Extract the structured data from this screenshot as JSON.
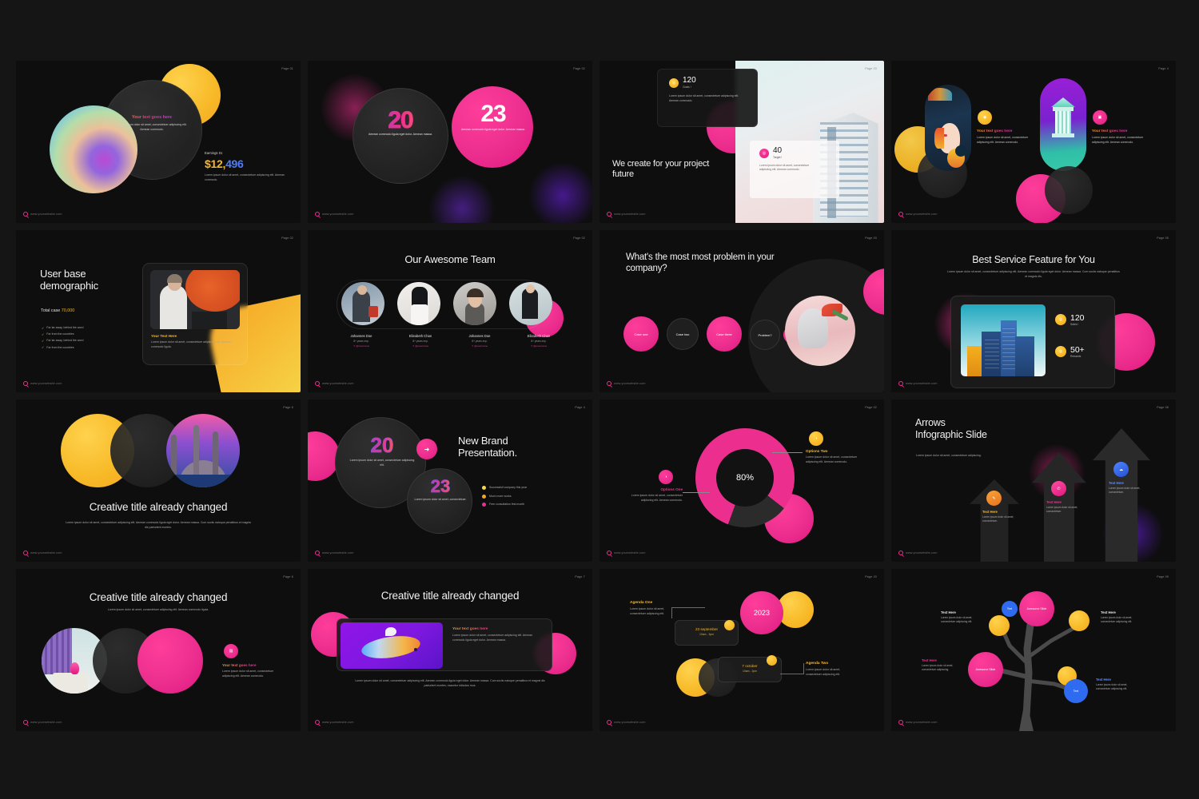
{
  "meta": {
    "canvas_background": "#151515",
    "slide_background": "#0e0e0e",
    "accent_pink": "#ec2f8f",
    "accent_yellow": "#f5a623",
    "accent_purple": "#7b5cf0",
    "accent_blue": "#2f6bf0",
    "footer_url": "www.yourwebsite.com"
  },
  "common": {
    "lorem_short": "Lorem ipsum dolor sit amet, consectetuer adipiscing elit. Aenean commodo.",
    "lorem_med": "Lorem ipsum dolor sit amet, consectetuer adipiscing elit. Aenean commodo ligula eget dolor. Aenean massa.",
    "aenean": "Aenean commodo ligula eget dolor. Aenean massa.",
    "your_text_goes_here": "Your text goes here",
    "text_here": "Text Here",
    "your_text_here": "Your Text Here"
  },
  "slides": [
    {
      "id": "slide-01-earnings",
      "page": "Page 01",
      "heading": "Your text goes here",
      "body": "Lorem ipsum dolor sit amet, consectetuer adipiscing elit. Aenean commodo.",
      "stat_label": "Earnings 01",
      "stat_value_a": "$12,",
      "stat_value_b": "496",
      "stat_body": "Lorem ipsum dolor sit amet, consectetuer adipiscing elit. Aenean commodo."
    },
    {
      "id": "slide-02-2023",
      "page": "Page 02",
      "left_number": "20",
      "right_number": "23",
      "left_body": "Aenean commodo ligula eget dolor. Aenean massa.",
      "right_body": "Aenean commodo ligula eget dolor. Aenean massa."
    },
    {
      "id": "slide-03-we-create",
      "page": "Page 03",
      "title": "We create for your project future",
      "stat_one_value": "120",
      "stat_one_label": "Goals !",
      "stat_one_body": "Lorem ipsum dolor sit amet, consectetuer adipiscing elit. Aenean commodo.",
      "stat_two_value": "40",
      "stat_two_label": "Target !",
      "stat_two_body": "Lorem ipsum dolor sit amet, consectetuer adipiscing elit. Aenean commodo."
    },
    {
      "id": "slide-04-two-features",
      "page": "Page 4",
      "left_heading": "Your text goes here",
      "left_body": "Lorem ipsum dolor sit amet, consectetuer adipiscing elit. Aenean commodo.",
      "right_heading": "Your text goes here",
      "right_body": "Lorem ipsum dolor sit amet, consectetuer adipiscing elit. Aenean commodo."
    },
    {
      "id": "slide-05-user-base",
      "page": "Page 02",
      "title_line1": "User base",
      "title_line2": "demographic",
      "total_label": "Total case",
      "total_value": "70,000",
      "bullets": [
        "Far far away, behind the word",
        "Far from the countries",
        "Far far away, behind the word",
        "Far from the countries"
      ],
      "card_heading": "Your Text Here",
      "card_body": "Lorem ipsum dolor sit amet, consectetuer adipiscing elit. Aenean commodo ligula."
    },
    {
      "id": "slide-06-team",
      "page": "Page 02",
      "title": "Our Awesome Team",
      "members": [
        {
          "name": "Johannes Doe",
          "role": "8+ years exp.",
          "handle": "@username"
        },
        {
          "name": "Elizabeth Chan",
          "role": "8+ years exp.",
          "handle": "@username"
        },
        {
          "name": "Johannes Doe",
          "role": "8+ years exp.",
          "handle": "@username"
        },
        {
          "name": "Elizabeth Chan",
          "role": "8+ years exp.",
          "handle": "@username"
        }
      ]
    },
    {
      "id": "slide-07-problem",
      "page": "Page 03",
      "title": "What's the most most problem in your company?",
      "cases": [
        "Case one",
        "Case two",
        "Case three",
        "Problem?"
      ]
    },
    {
      "id": "slide-08-best-service",
      "page": "Page 05",
      "title": "Best Service Feature for You",
      "subtitle": "Lorem ipsum dolor sit amet, consectetuer adipiscing elit. Aenean commodo ligula eget dolor. Aenean massa. Cum sociis natoque penatibus et magnis dis.",
      "stat_one_value": "120",
      "stat_one_label": "Sales !",
      "stat_two_value": "50+",
      "stat_two_label": "Rewards"
    },
    {
      "id": "slide-09-creative-circles",
      "page": "Page 6",
      "title": "Creative title already changed",
      "body": "Lorem ipsum dolor sit amet, consectetuer adipiscing elit. Aenean commodo ligula eget dolor. Aenean massa. Cum sociis natoque penatibus et magnis dis parturient montes."
    },
    {
      "id": "slide-10-new-brand",
      "page": "Page 4",
      "number_one": "20",
      "number_two": "23",
      "number_one_body": "Lorem ipsum dolor sit amet, consectetuer adipiscing elit.",
      "number_two_body": "Lorem ipsum dolor sit amet, consectetuer.",
      "title_line1": "New Brand",
      "title_line2": "Presentation.",
      "bullets": [
        {
          "text": "Successfull company this year",
          "color": "#f7d84d"
        },
        {
          "text": "Much more works",
          "color": "#f5a623"
        },
        {
          "text": "Free consultation first month",
          "color": "#ec2f8f"
        }
      ]
    },
    {
      "id": "slide-11-donut",
      "page": "Page 02",
      "center_value": "80%",
      "option_one_title": "Options One",
      "option_one_body": "Lorem ipsum dolor sit amet, consectetuer adipiscing elit. Aenean commodo.",
      "option_two_title": "Options Two",
      "option_two_body": "Lorem ipsum dolor sit amet, consectetuer adipiscing elit. Aenean commodo.",
      "chart_data": {
        "type": "pie",
        "title": "80%",
        "categories": [
          "Options One",
          "Options Two"
        ],
        "values": [
          80,
          20
        ],
        "colors": [
          "#ec2f8f",
          "#2b2b2b"
        ],
        "legend": "right"
      }
    },
    {
      "id": "slide-12-arrows",
      "page": "Page 08",
      "title_line1": "Arrows",
      "title_line2": "Infographic Slide",
      "subtitle": "Lorem ipsum dolor sit amet, consectetuer adipiscing.",
      "items": [
        {
          "label": "Text Here",
          "body": "Lorem ipsum dolor sit amet, consectetuer.",
          "color": "#f5a623"
        },
        {
          "label": "Text Here",
          "body": "Lorem ipsum dolor sit amet, consectetuer.",
          "color": "#ec2f8f"
        },
        {
          "label": "Text Here",
          "body": "Lorem ipsum dolor sit amet, consectetuer.",
          "color": "#2f6bf0"
        }
      ]
    },
    {
      "id": "slide-13-creative-three",
      "page": "Page 8",
      "title": "Creative title already changed",
      "subtitle": "Lorem ipsum dolor sit amet, consectetuer adipiscing elit. Aenean commodo ligula.",
      "side_heading": "Your text goes here",
      "side_body": "Lorem ipsum dolor sit amet, consectetuer adipiscing elit. Aenean commodo."
    },
    {
      "id": "slide-14-phone",
      "page": "Page 7",
      "title": "Creative title already changed",
      "card_heading": "Your text goes here",
      "card_body": "Lorem ipsum dolor sit amet, consectetuer adipiscing elit. Aenean commodo ligula eget dolor. Aenean massa.",
      "bottom_body": "Lorem ipsum dolor sit amet, consectetuer adipiscing elit. Aenean commodo ligula eget dolor. Aenean massa. Cum sociis natoque penatibus et magnis dis parturient montes, nascetur ridiculus mus."
    },
    {
      "id": "slide-15-agenda",
      "page": "Page 20",
      "year": "2023",
      "agenda_one_title": "Agenda One",
      "agenda_one_body": "Lorem ipsum dolor sit amet, consectetuer adipiscing elit.",
      "agenda_two_title": "Agenda Two",
      "agenda_two_body": "Lorem ipsum dolor sit amet, consectetuer adipiscing elit.",
      "date_one": "23 september",
      "time_one": "10am - 3pm",
      "date_two": "7 october",
      "time_two": "10am - 2pm"
    },
    {
      "id": "slide-16-tree",
      "page": "Page 09",
      "nodes": [
        {
          "label": "Text",
          "color": "#2f6bf0"
        },
        {
          "label": "Awesome Slide",
          "color": "#ec2f8f"
        },
        {
          "label": "Awesome Slide",
          "color": "#ec2f8f"
        },
        {
          "label": "Text",
          "color": "#2f6bf0"
        }
      ],
      "callouts": [
        {
          "title": "Text Here",
          "body": "Lorem ipsum dolor sit amet, consectetuer adipiscing elit.",
          "color": "#e8e8e8"
        },
        {
          "title": "Text Here",
          "body": "Lorem ipsum dolor sit amet, consectetuer adipiscing elit.",
          "color": "#e8e8e8"
        },
        {
          "title": "Text Here",
          "body": "Lorem ipsum dolor sit amet, consectetuer adipiscing.",
          "color": "#ec2f8f"
        },
        {
          "title": "Text Here",
          "body": "Lorem ipsum dolor sit amet, consectetuer adipiscing elit.",
          "color": "#2f6bf0"
        }
      ]
    }
  ]
}
